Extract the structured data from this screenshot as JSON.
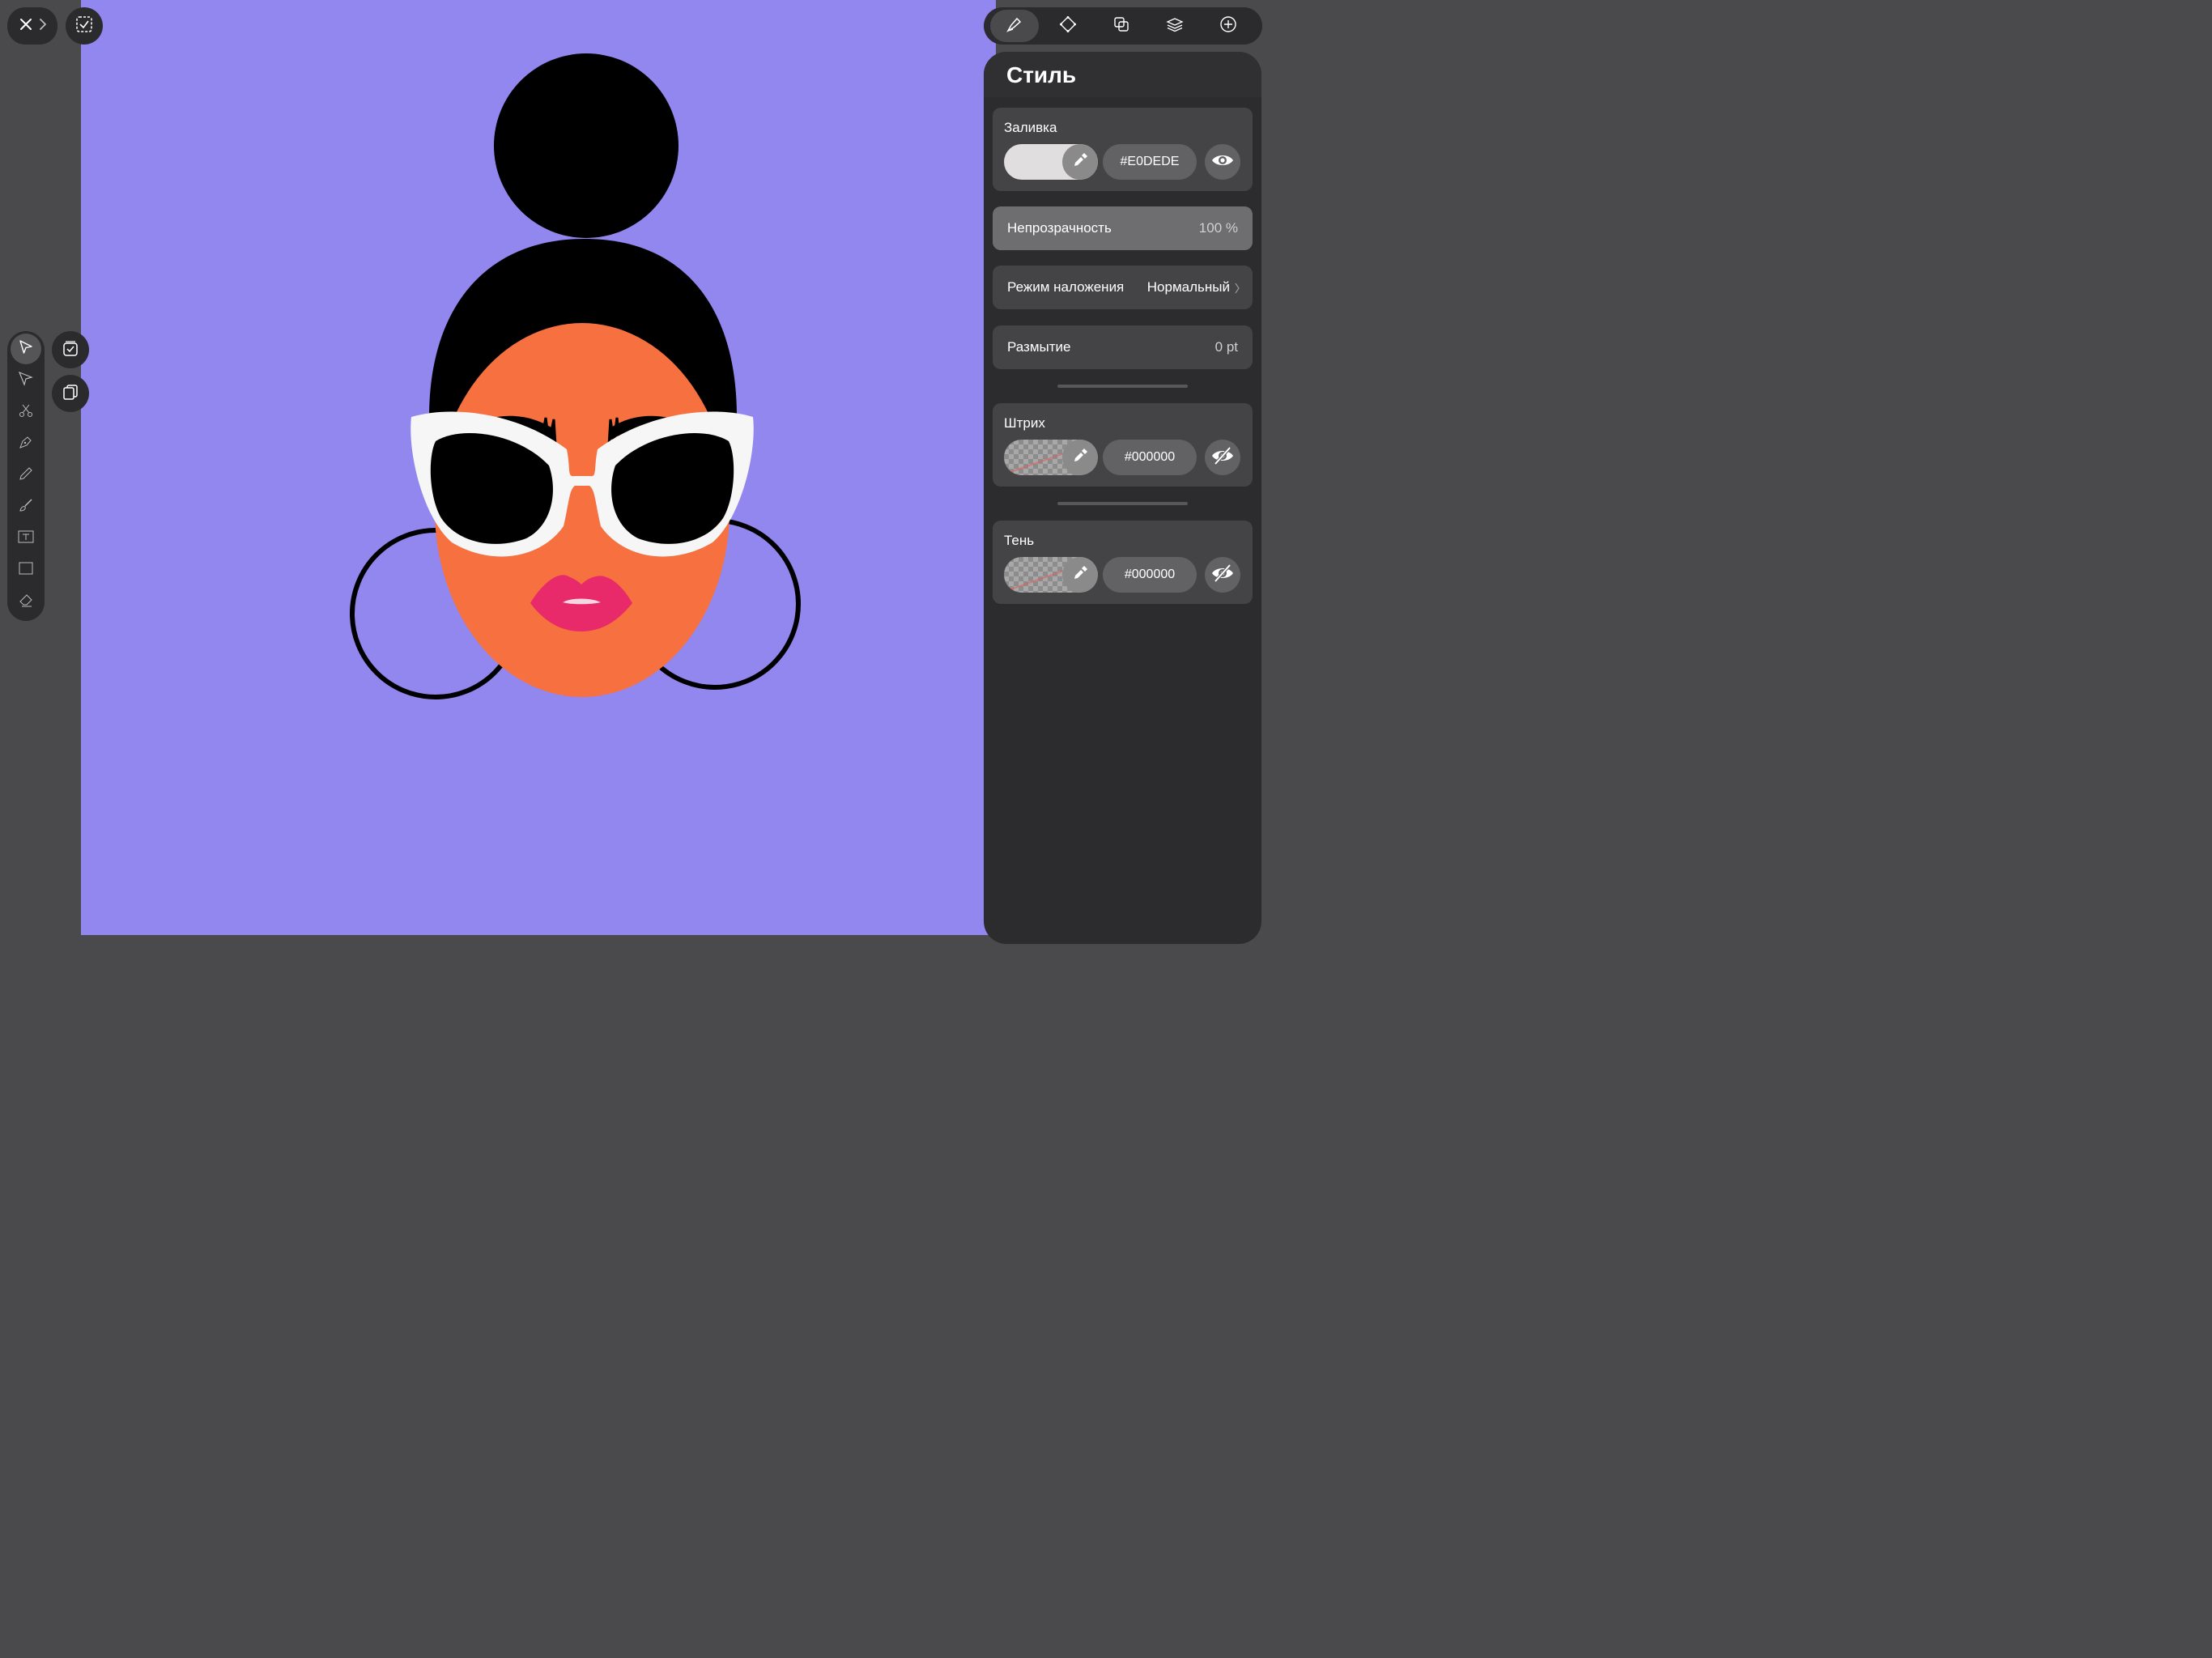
{
  "panel": {
    "title": "Стиль",
    "fill": {
      "label": "Заливка",
      "hex": "#E0DEDE",
      "swatch_color": "#E0DEDE",
      "visible": true
    },
    "opacity": {
      "label": "Непрозрачность",
      "value": "100 %"
    },
    "blend": {
      "label": "Режим наложения",
      "value": "Нормальный"
    },
    "blur": {
      "label": "Размытие",
      "value": "0 pt"
    },
    "stroke": {
      "label": "Штрих",
      "hex": "#000000",
      "visible": false
    },
    "shadow": {
      "label": "Тень",
      "hex": "#000000",
      "visible": false
    }
  },
  "tabs": [
    "style-icon",
    "shape-icon",
    "boolean-icon",
    "layers-icon",
    "add-icon"
  ],
  "tools": [
    "selection-arrow-icon",
    "direct-selection-icon",
    "scissors-icon",
    "pen-icon",
    "pencil-icon",
    "brush-icon",
    "text-icon",
    "rectangle-icon",
    "eraser-icon"
  ],
  "colors": {
    "canvas": "#9287EE",
    "face": "#F7703F",
    "lips": "#E8296A",
    "hair": "#000000",
    "glasses_frame": "#F6F6F6"
  }
}
